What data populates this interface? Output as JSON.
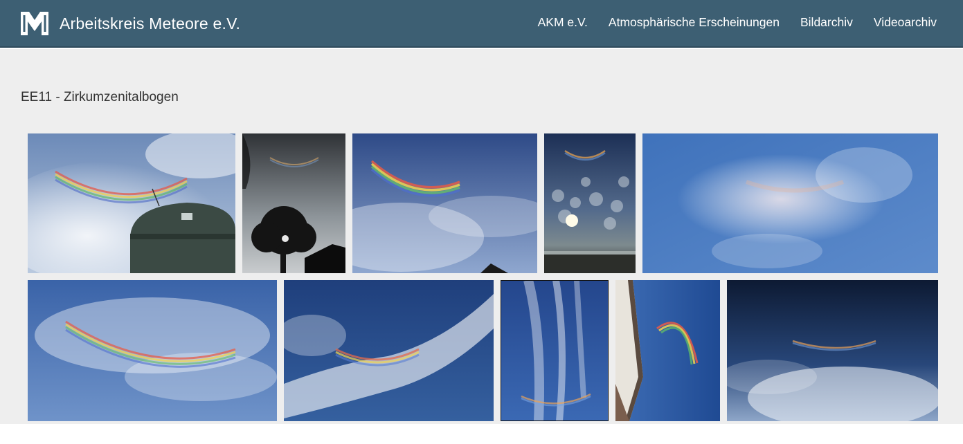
{
  "site": {
    "brand_name": "Arbeitskreis Meteore e.V.",
    "logo_icon": "akm-logo-icon"
  },
  "nav": {
    "items": [
      {
        "label": "AKM e.V."
      },
      {
        "label": "Atmosphärische Erscheinungen"
      },
      {
        "label": "Bildarchiv"
      },
      {
        "label": "Videoarchiv"
      }
    ]
  },
  "page": {
    "title": "EE11 - Zirkumzenitalbogen"
  },
  "gallery": {
    "rows": [
      [
        {
          "subject": "circumzenithal arc over observatory dome"
        },
        {
          "subject": "faint arc above tree silhouette"
        },
        {
          "subject": "bright arc in cirrus"
        },
        {
          "subject": "arc above altocumulus and sun"
        },
        {
          "subject": "diffuse iridescent cirrus"
        }
      ],
      [
        {
          "subject": "arc in veil of cirrus"
        },
        {
          "subject": "arc in streak of cirrus"
        },
        {
          "subject": "arc under wispy cirrus"
        },
        {
          "subject": "arc beside building wall"
        },
        {
          "subject": "faint arc in dark sky"
        }
      ]
    ]
  },
  "colors": {
    "navbar": "#3d5f73",
    "content_bg": "#eeeeee",
    "title_text": "#333333"
  }
}
